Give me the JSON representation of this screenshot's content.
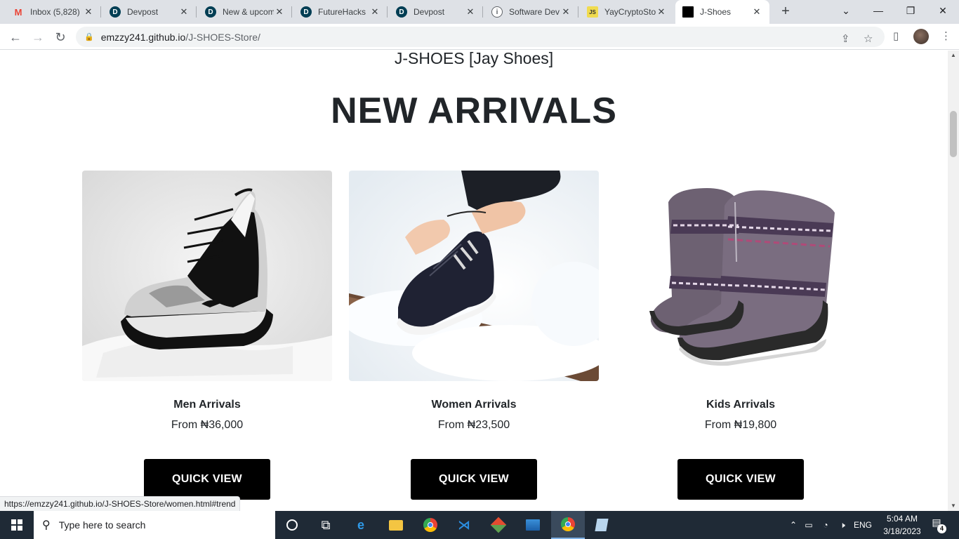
{
  "browser": {
    "tabs": [
      {
        "title": "Inbox (5,828)",
        "favicon": "M",
        "favicon_color": "#ea4335"
      },
      {
        "title": "Devpost",
        "favicon": "D",
        "favicon_color": "#003e54"
      },
      {
        "title": "New & upcoming",
        "favicon": "D",
        "favicon_color": "#003e54"
      },
      {
        "title": "FutureHacks",
        "favicon": "D",
        "favicon_color": "#003e54"
      },
      {
        "title": "Devpost",
        "favicon": "D",
        "favicon_color": "#003e54"
      },
      {
        "title": "Software Dev",
        "favicon": "i",
        "favicon_color": "#5f6368"
      },
      {
        "title": "YayCryptoStore",
        "favicon": "JS",
        "favicon_color": "#f0db4f"
      },
      {
        "title": "J-Shoes",
        "favicon": "J",
        "favicon_color": "#000000"
      }
    ],
    "active_tab": 7,
    "url_host": "emzzy241.github.io",
    "url_path": "/J-SHOES-Store/"
  },
  "page": {
    "site_title": "J-SHOES [Jay Shoes]",
    "section_title": "NEW ARRIVALS",
    "cards": [
      {
        "name": "Men Arrivals",
        "price": "From ₦36,000",
        "button": "QUICK VIEW"
      },
      {
        "name": "Women Arrivals",
        "price": "From ₦23,500",
        "button": "QUICK VIEW"
      },
      {
        "name": "Kids Arrivals",
        "price": "From ₦19,800",
        "button": "QUICK VIEW"
      }
    ]
  },
  "status_url": "https://emzzy241.github.io/J-SHOES-Store/women.html#trend",
  "taskbar": {
    "search_placeholder": "Type here to search",
    "language": "ENG",
    "time": "5:04 AM",
    "date": "3/18/2023",
    "notifications": "4"
  },
  "icons": {
    "back": "arrow-left-icon",
    "forward": "arrow-right-icon",
    "reload": "reload-icon",
    "lock": "lock-icon",
    "share": "share-icon",
    "bookmark": "star-icon",
    "sidepanel": "side-panel-icon",
    "menu": "kebab-menu-icon"
  }
}
